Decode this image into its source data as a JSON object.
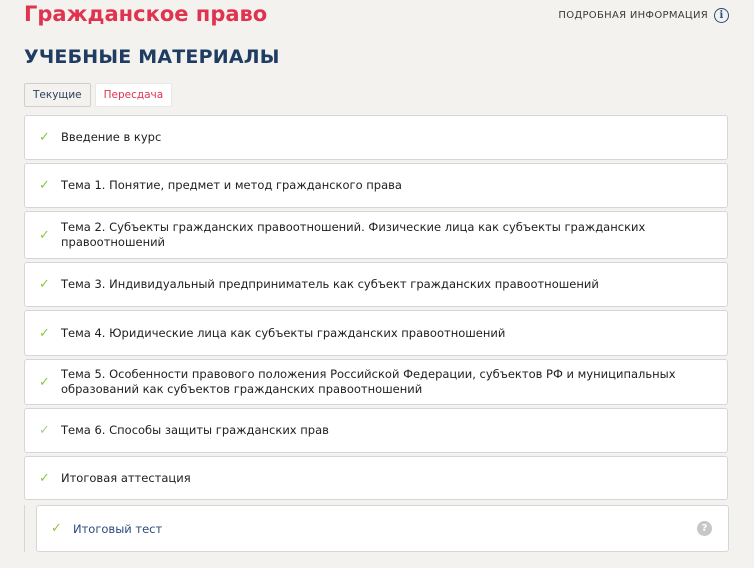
{
  "header": {
    "course_title": "Гражданское право",
    "info_link": "ПОДРОБНАЯ ИНФОРМАЦИЯ",
    "info_icon": "i"
  },
  "section": {
    "title": "УЧЕБНЫЕ МАТЕРИАЛЫ"
  },
  "tabs": [
    {
      "label": "Текущие",
      "active": true
    },
    {
      "label": "Пересдача",
      "active": false
    }
  ],
  "items": [
    {
      "label": "Введение в курс",
      "status": "done"
    },
    {
      "label": "Тема 1. Понятие, предмет и метод гражданского права",
      "status": "done"
    },
    {
      "label": "Тема 2. Субъекты гражданских правоотношений. Физические лица как субъекты гражданских правоотношений",
      "status": "done"
    },
    {
      "label": "Тема 3. Индивидуальный предприниматель как субъект гражданских правоотношений",
      "status": "done"
    },
    {
      "label": "Тема 4. Юридические лица как субъекты гражданских правоотношений",
      "status": "done"
    },
    {
      "label": "Тема 5. Особенности правового положения Российской Федерации, субъектов РФ и муниципальных образований как субъектов гражданских правоотношений",
      "status": "done"
    },
    {
      "label": "Тема 6. Способы защиты гражданских прав",
      "status": "partial"
    },
    {
      "label": "Итоговая аттестация",
      "status": "done"
    }
  ],
  "child": {
    "label": "Итоговый тест",
    "status": "done",
    "help": "?"
  },
  "icons": {
    "check": "✓"
  },
  "colors": {
    "accent": "#e0334f",
    "heading": "#1f3d63",
    "check": "#8dc63f"
  }
}
